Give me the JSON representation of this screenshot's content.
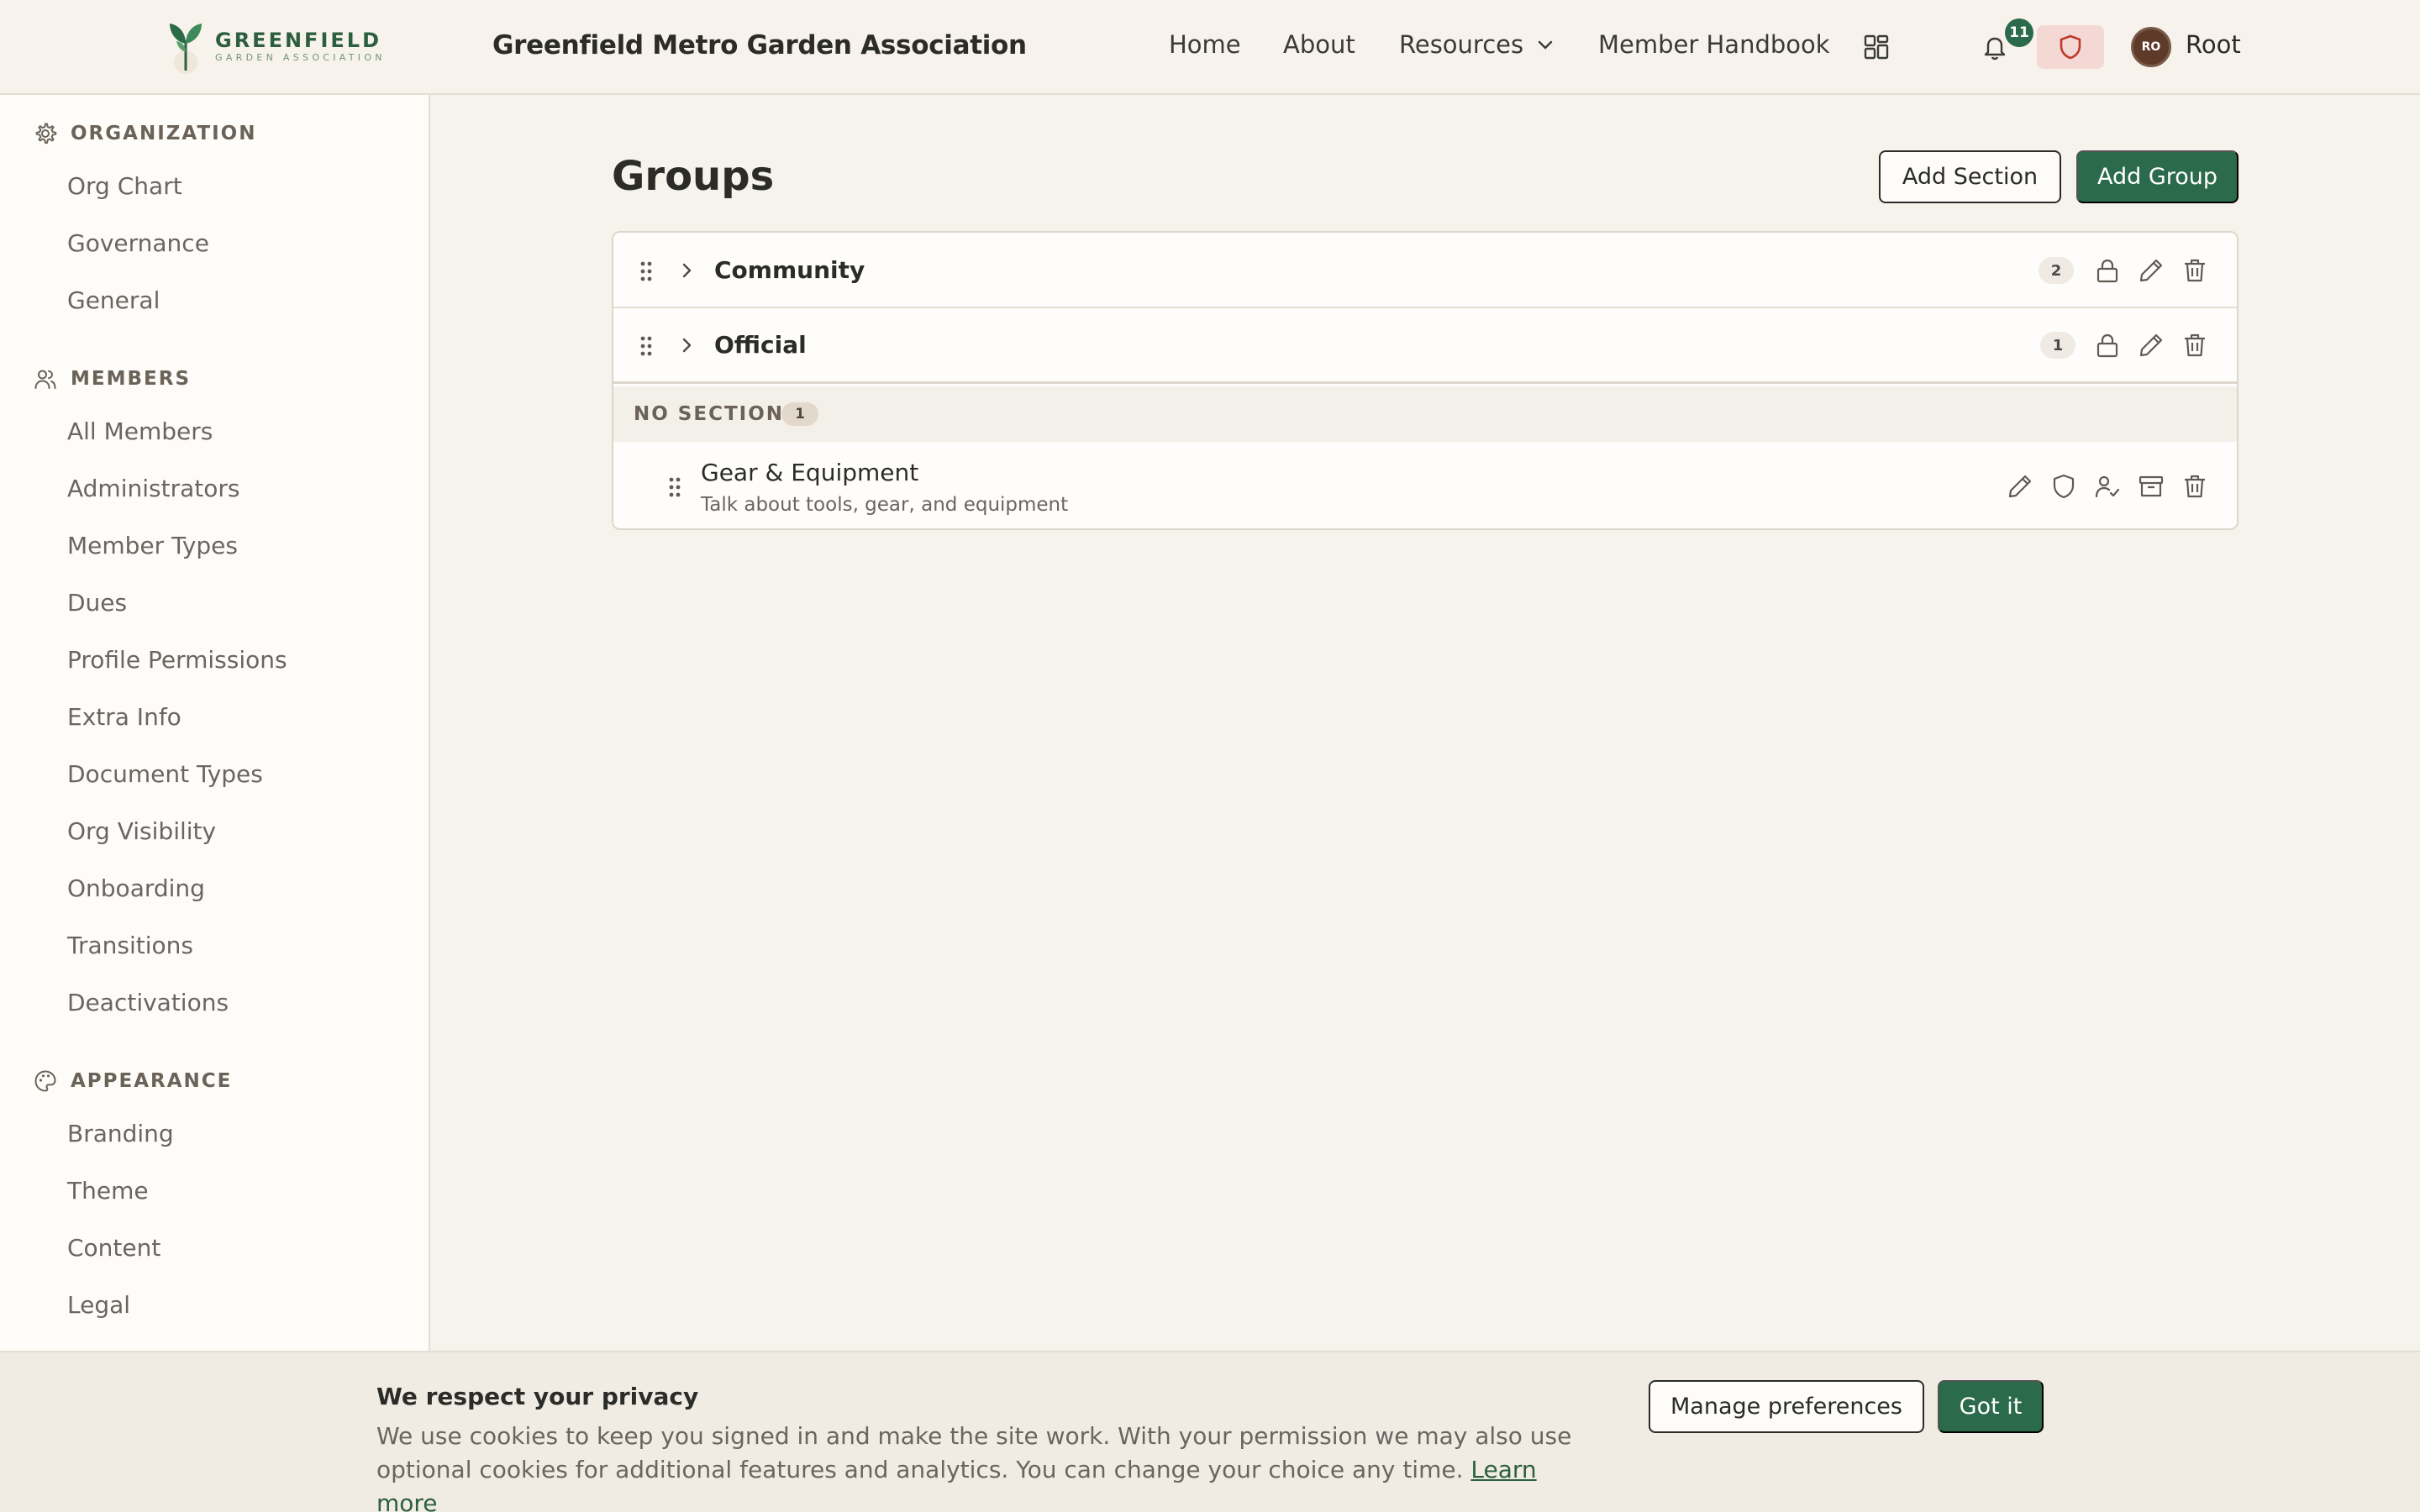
{
  "colors": {
    "brand_green": "#2b6a4a",
    "background": "#f6f2ec",
    "sidebar_background": "#fdfcf9",
    "shield_button_bg": "#f3d8d3",
    "shield_icon": "#c0392b"
  },
  "logo": {
    "name": "GREENFIELD",
    "subtitle": "GARDEN ASSOCIATION",
    "icon": "sprout-logo"
  },
  "header": {
    "site_title": "Greenfield Metro Garden Association",
    "nav": {
      "home": "Home",
      "about": "About",
      "resources": "Resources",
      "handbook": "Member Handbook"
    },
    "notification_count": "11",
    "user": {
      "initials": "RO",
      "name": "Root"
    }
  },
  "sidebar": {
    "organization": {
      "label": "ORGANIZATION",
      "icon": "gear-icon",
      "items": [
        "Org Chart",
        "Governance",
        "General"
      ]
    },
    "members": {
      "label": "MEMBERS",
      "icon": "users-icon",
      "items": [
        "All Members",
        "Administrators",
        "Member Types",
        "Dues",
        "Profile Permissions",
        "Extra Info",
        "Document Types",
        "Org Visibility",
        "Onboarding",
        "Transitions",
        "Deactivations"
      ]
    },
    "appearance": {
      "label": "APPEARANCE",
      "icon": "palette-icon",
      "items": [
        "Branding",
        "Theme",
        "Content",
        "Legal"
      ]
    }
  },
  "main": {
    "title": "Groups",
    "add_section_label": "Add Section",
    "add_group_label": "Add Group",
    "sections": [
      {
        "name": "Community",
        "count": "2"
      },
      {
        "name": "Official",
        "count": "1"
      }
    ],
    "no_section": {
      "label": "NO SECTION",
      "count": "1",
      "groups": [
        {
          "name": "Gear & Equipment",
          "description": "Talk about tools, gear, and equipment"
        }
      ]
    }
  },
  "cookie": {
    "title": "We respect your privacy",
    "text": "We use cookies to keep you signed in and make the site work. With your permission we may also use optional cookies for additional features and analytics. You can change your choice any time.",
    "link": "Learn more",
    "manage_label": "Manage preferences",
    "accept_label": "Got it"
  }
}
